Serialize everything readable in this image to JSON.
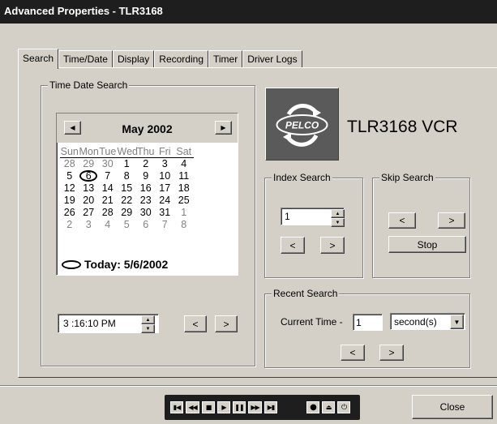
{
  "window": {
    "title": "Advanced Properties - TLR3168"
  },
  "tabs": [
    "Search",
    "Time/Date",
    "Display",
    "Recording",
    "Timer",
    "Driver Logs"
  ],
  "time_date_search": {
    "title": "Time Date Search",
    "calendar": {
      "month_label": "May 2002",
      "days_of_week": [
        "Sun",
        "Mon",
        "Tue",
        "Wed",
        "Thu",
        "Fri",
        "Sat"
      ],
      "weeks": [
        [
          "28",
          "29",
          "30",
          "1",
          "2",
          "3",
          "4"
        ],
        [
          "5",
          "6",
          "7",
          "8",
          "9",
          "10",
          "11"
        ],
        [
          "12",
          "13",
          "14",
          "15",
          "16",
          "17",
          "18"
        ],
        [
          "19",
          "20",
          "21",
          "22",
          "23",
          "24",
          "25"
        ],
        [
          "26",
          "27",
          "28",
          "29",
          "30",
          "31",
          "1"
        ],
        [
          "2",
          "3",
          "4",
          "5",
          "6",
          "7",
          "8"
        ]
      ],
      "today_label": "Today: 5/6/2002"
    },
    "time_value": "3 :16:10 PM",
    "prev_label": "<",
    "next_label": ">"
  },
  "device": {
    "logo_text": "PELCO",
    "name": "TLR3168 VCR"
  },
  "index_search": {
    "title": "Index Search",
    "value": "1",
    "prev_label": "<",
    "next_label": ">"
  },
  "skip_search": {
    "title": "Skip Search",
    "prev_label": "<",
    "next_label": ">",
    "stop_label": "Stop"
  },
  "recent_search": {
    "title": "Recent Search",
    "current_time_label": "Current Time -",
    "amount_value": "1",
    "unit_value": "second(s)",
    "prev_label": "<",
    "next_label": ">"
  },
  "transport": {
    "buttons": [
      "skip-to-start",
      "rewind",
      "stop",
      "play",
      "pause",
      "fast-forward",
      "skip-to-end",
      "record",
      "eject",
      "power"
    ]
  },
  "footer": {
    "close_label": "Close"
  }
}
